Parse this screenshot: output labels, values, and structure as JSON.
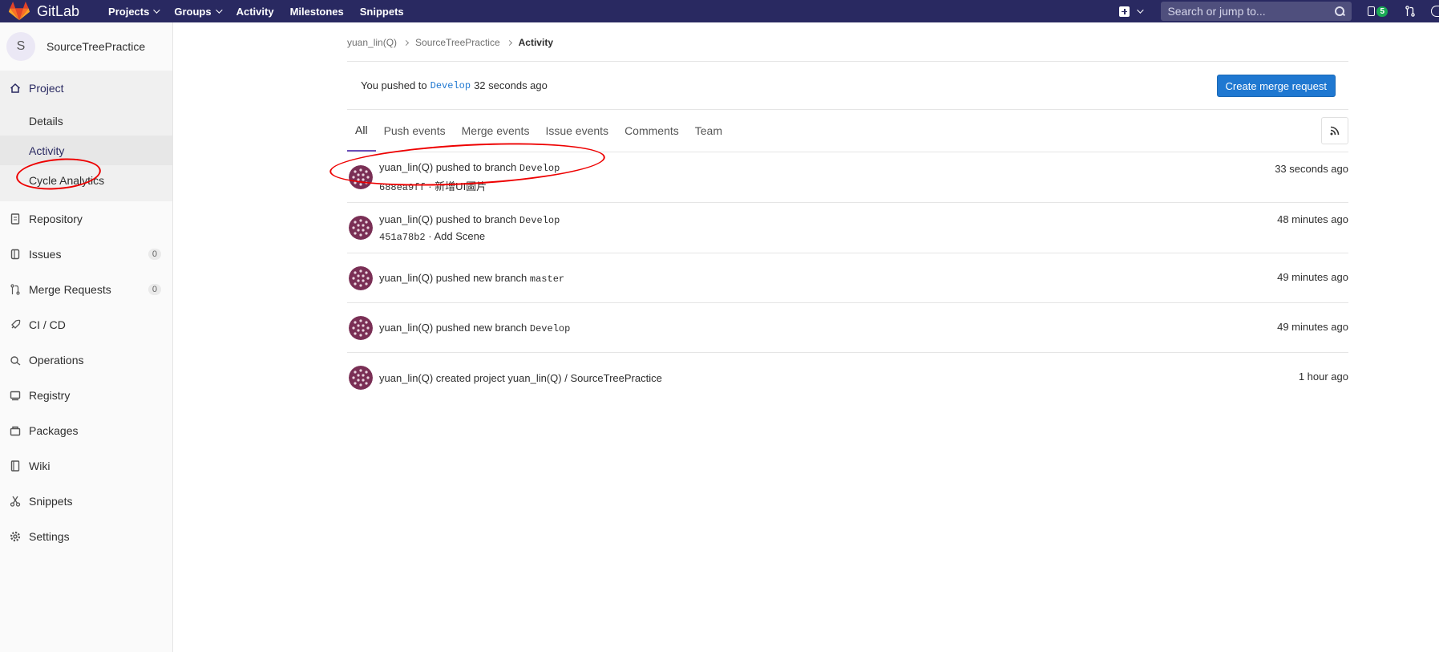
{
  "navbar": {
    "brand": "GitLab",
    "links": [
      "Projects",
      "Groups",
      "Activity",
      "Milestones",
      "Snippets"
    ],
    "search_placeholder": "Search or jump to...",
    "todo_count": "5"
  },
  "sidebar": {
    "project_initial": "S",
    "project_name": "SourceTreePractice",
    "project_section": "Project",
    "sub_items": [
      "Details",
      "Activity",
      "Cycle Analytics"
    ],
    "items": [
      {
        "label": "Repository"
      },
      {
        "label": "Issues",
        "count": "0"
      },
      {
        "label": "Merge Requests",
        "count": "0"
      },
      {
        "label": "CI / CD"
      },
      {
        "label": "Operations"
      },
      {
        "label": "Registry"
      },
      {
        "label": "Packages"
      },
      {
        "label": "Wiki"
      },
      {
        "label": "Snippets"
      },
      {
        "label": "Settings"
      }
    ]
  },
  "breadcrumb": [
    "yuan_lin(Q)",
    "SourceTreePractice",
    "Activity"
  ],
  "push_alert": {
    "prefix": "You pushed to",
    "branch": "Develop",
    "suffix": "32 seconds ago",
    "button": "Create merge request"
  },
  "tabs": [
    "All",
    "Push events",
    "Merge events",
    "Issue events",
    "Comments",
    "Team"
  ],
  "events": [
    {
      "text": "yuan_lin(Q) pushed to branch",
      "ref": "Develop",
      "sha": "688ea9ff",
      "message": "· 新增UI圖片",
      "time": "33 seconds ago"
    },
    {
      "text": "yuan_lin(Q) pushed to branch",
      "ref": "Develop",
      "sha": "451a78b2",
      "message": "· Add Scene",
      "time": "48 minutes ago"
    },
    {
      "text": "yuan_lin(Q) pushed new branch",
      "ref": "master",
      "time": "49 minutes ago"
    },
    {
      "text": "yuan_lin(Q) pushed new branch",
      "ref": "Develop",
      "time": "49 minutes ago"
    },
    {
      "text": "yuan_lin(Q) created project yuan_lin(Q) / SourceTreePractice",
      "ref": "",
      "time": "1 hour ago"
    }
  ]
}
